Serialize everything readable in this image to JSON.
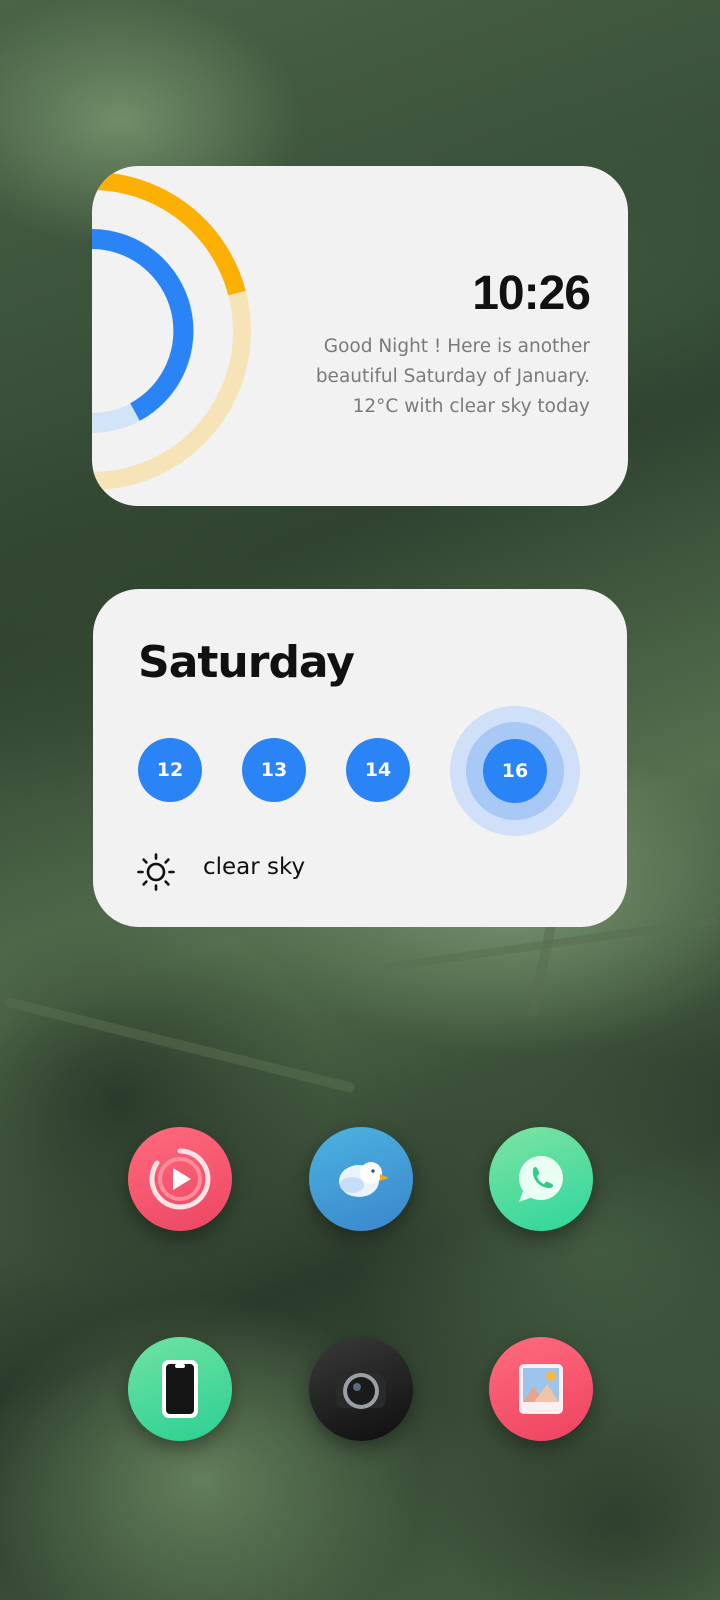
{
  "clock_widget": {
    "time": "10:26",
    "message": "Good Night ! Here is another beautiful Saturday of January. 12°C with clear sky today"
  },
  "weather_widget": {
    "day": "Saturday",
    "dates": [
      "12",
      "13",
      "14",
      "16"
    ],
    "condition": "clear sky",
    "condition_icon": "sun-icon"
  },
  "apps": [
    {
      "name": "music-player-app-icon",
      "color": "#f0546a"
    },
    {
      "name": "bird-app-icon",
      "color": "#3f9bd6"
    },
    {
      "name": "whatsapp-app-icon",
      "color": "#44d89a"
    },
    {
      "name": "phone-app-icon",
      "color": "#3ed895"
    },
    {
      "name": "camera-app-icon",
      "color": "#1e1e1e"
    },
    {
      "name": "gallery-app-icon",
      "color": "#f24e66"
    }
  ],
  "colors": {
    "accent_blue": "#2b84f6",
    "accent_orange": "#fcb004",
    "widget_bg": "#f2f2f2"
  }
}
